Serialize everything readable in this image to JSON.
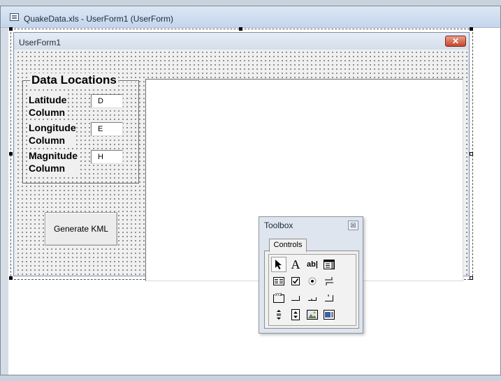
{
  "window": {
    "title": "QuakeData.xls - UserForm1 (UserForm)"
  },
  "userform": {
    "title": "UserForm1",
    "close_glyph": "✕",
    "frame": {
      "title": "Data Locations",
      "fields": [
        {
          "label_line1": "Latitude",
          "label_line2": "Column",
          "value": "D"
        },
        {
          "label_line1": "Longitude",
          "label_line2": "Column",
          "value": "E"
        },
        {
          "label_line1": "Magnitude",
          "label_line2": "Column",
          "value": "H"
        }
      ]
    },
    "generate_button_label": "Generate KML"
  },
  "toolbox": {
    "title": "Toolbox",
    "close_glyph": "☒",
    "tab_label": "Controls",
    "tools": [
      {
        "name": "select-objects-icon",
        "glyph": ""
      },
      {
        "name": "label-tool-icon",
        "glyph": "A"
      },
      {
        "name": "textbox-tool-icon",
        "glyph": "ab|"
      },
      {
        "name": "combobox-tool-icon",
        "glyph": ""
      },
      {
        "name": "listbox-tool-icon",
        "glyph": ""
      },
      {
        "name": "checkbox-tool-icon",
        "glyph": ""
      },
      {
        "name": "optionbutton-tool-icon",
        "glyph": ""
      },
      {
        "name": "togglebutton-tool-icon",
        "glyph": ""
      },
      {
        "name": "frame-tool-icon",
        "glyph": ""
      },
      {
        "name": "commandbutton-tool-icon",
        "glyph": ""
      },
      {
        "name": "tabstrip-tool-icon",
        "glyph": ""
      },
      {
        "name": "multipage-tool-icon",
        "glyph": ""
      },
      {
        "name": "scrollbar-tool-icon",
        "glyph": ""
      },
      {
        "name": "spinbutton-tool-icon",
        "glyph": ""
      },
      {
        "name": "image-tool-icon",
        "glyph": ""
      },
      {
        "name": "refedit-tool-icon",
        "glyph": ""
      }
    ]
  }
}
